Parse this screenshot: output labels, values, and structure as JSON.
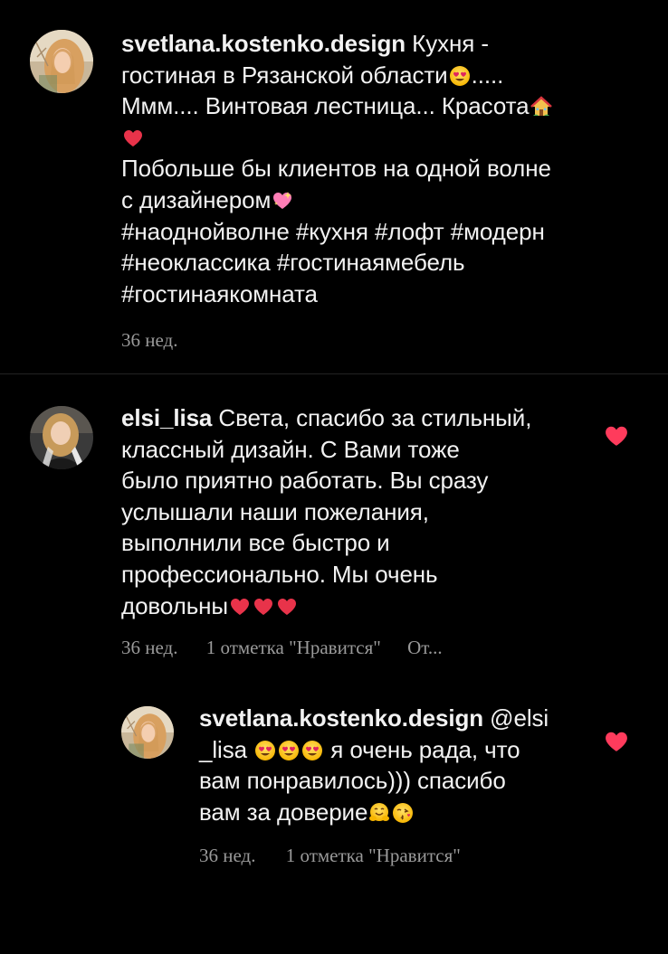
{
  "colors": {
    "background": "#000000",
    "text": "#f2f2f2",
    "meta": "#9a9a9a",
    "heart": "#ff3b5c"
  },
  "comment1": {
    "username": "svetlana.kostenko.design",
    "text_line1": " Кухня -",
    "text_line2": "гостиная в Рязанской области",
    "text_line2_tail": ".....",
    "text_line3": "Ммм.... Винтовая лестница... Красота",
    "text_line5": "Побольше бы клиентов на одной волне",
    "text_line6": "с дизайнером",
    "text_line7": "#наоднойволне #кухня #лофт #модерн",
    "text_line8": "#неоклассика #гостинаямебель",
    "text_line9": "#гостинаякомната",
    "time": "36 нед."
  },
  "comment2": {
    "username": "elsi_lisa",
    "text_line1": " Света, спасибо за стильный,",
    "text_line2": "классный дизайн. С Вами тоже",
    "text_line3": "было приятно работать. Вы сразу",
    "text_line4": "услышали наши пожелания,",
    "text_line5": "выполнили все быстро и",
    "text_line6": "профессионально. Мы очень",
    "text_line7": "довольны",
    "time": "36 нед.",
    "likes": "1 отметка \"Нравится\"",
    "reply": "От..."
  },
  "comment3": {
    "username": "svetlana.kostenko.design",
    "mention_line1": " @elsi",
    "mention_line2": "_lisa",
    "text_line2": " я очень рада, что",
    "text_line3": "вам понравилось))) спасибо",
    "text_line4": "вам за доверие",
    "time": "36 нед.",
    "likes": "1 отметка \"Нравится\""
  }
}
